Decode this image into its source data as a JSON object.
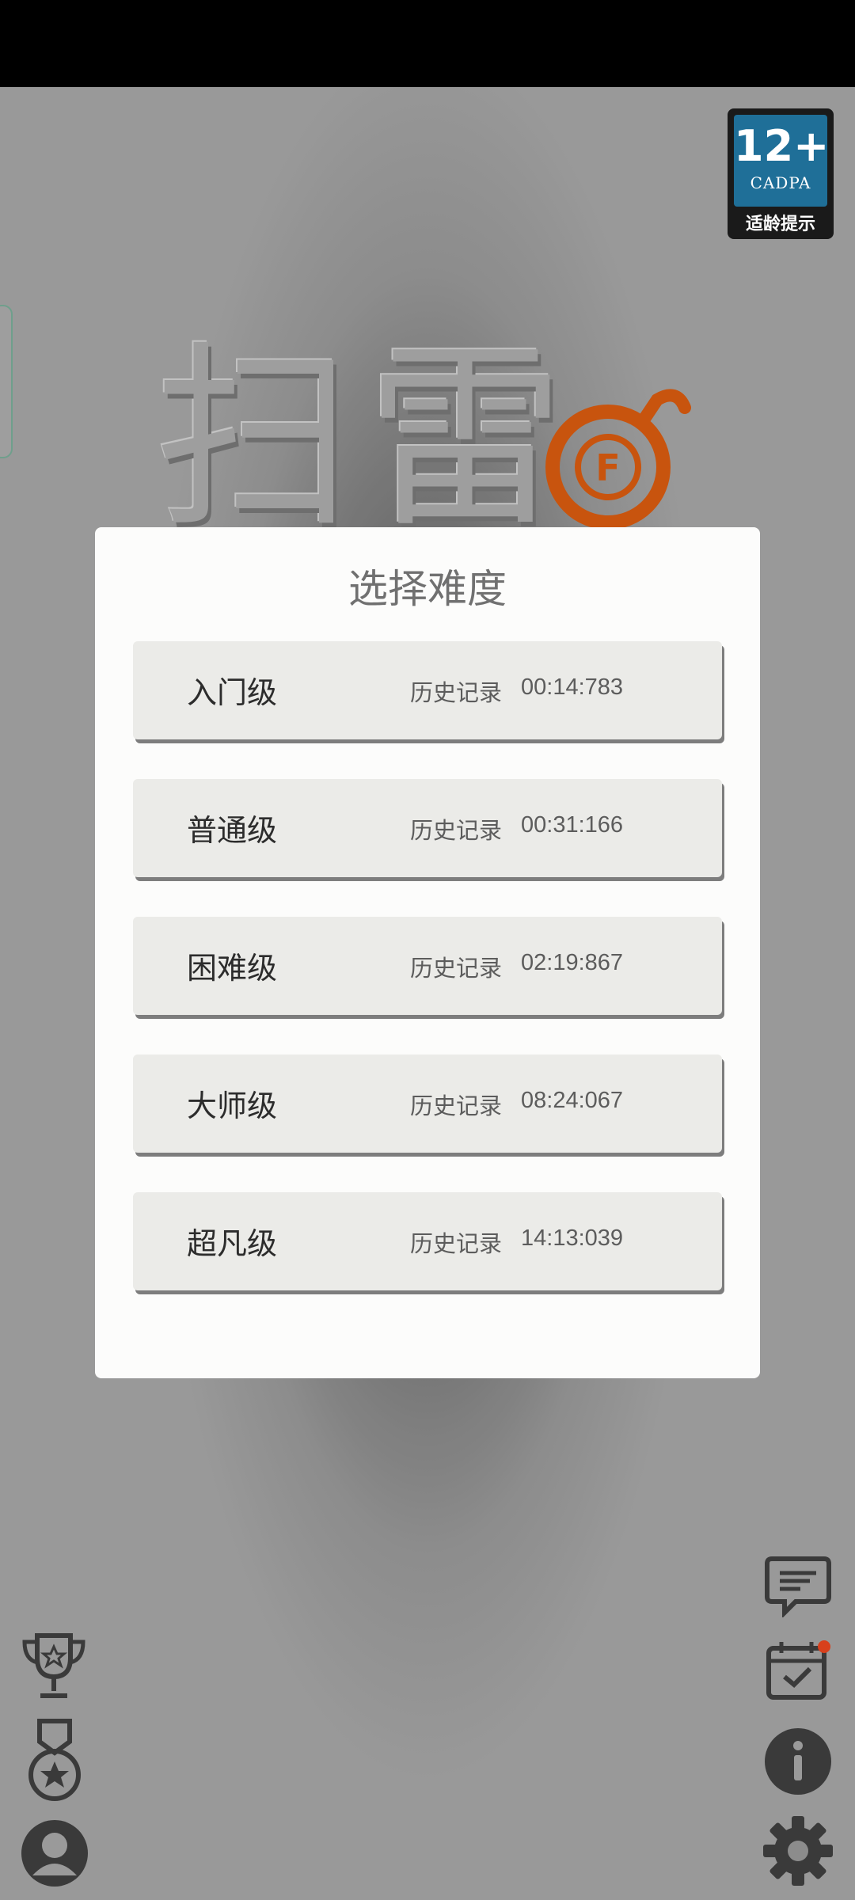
{
  "age_badge": {
    "rating": "12+",
    "org": "CADPA",
    "tip": "适龄提示"
  },
  "logo": {
    "title": "扫雷",
    "bomb_letter": "F",
    "bomb_color": "#c8540e"
  },
  "dialog": {
    "title": "选择难度",
    "levels": [
      {
        "name": "入门级",
        "record_label": "历史记录",
        "time": "00:14:783"
      },
      {
        "name": "普通级",
        "record_label": "历史记录",
        "time": "00:31:166"
      },
      {
        "name": "困难级",
        "record_label": "历史记录",
        "time": "02:19:867"
      },
      {
        "name": "大师级",
        "record_label": "历史记录",
        "time": "08:24:067"
      },
      {
        "name": "超凡级",
        "record_label": "历史记录",
        "time": "14:13:039"
      }
    ]
  },
  "left_icons": [
    "trophy-icon",
    "medal-icon",
    "profile-icon"
  ],
  "right_icons": [
    "feedback-icon",
    "checkin-calendar-icon",
    "info-icon",
    "settings-gear-icon"
  ],
  "colors": {
    "notification_dot": "#d8401c",
    "icon": "#3a3a3a"
  }
}
